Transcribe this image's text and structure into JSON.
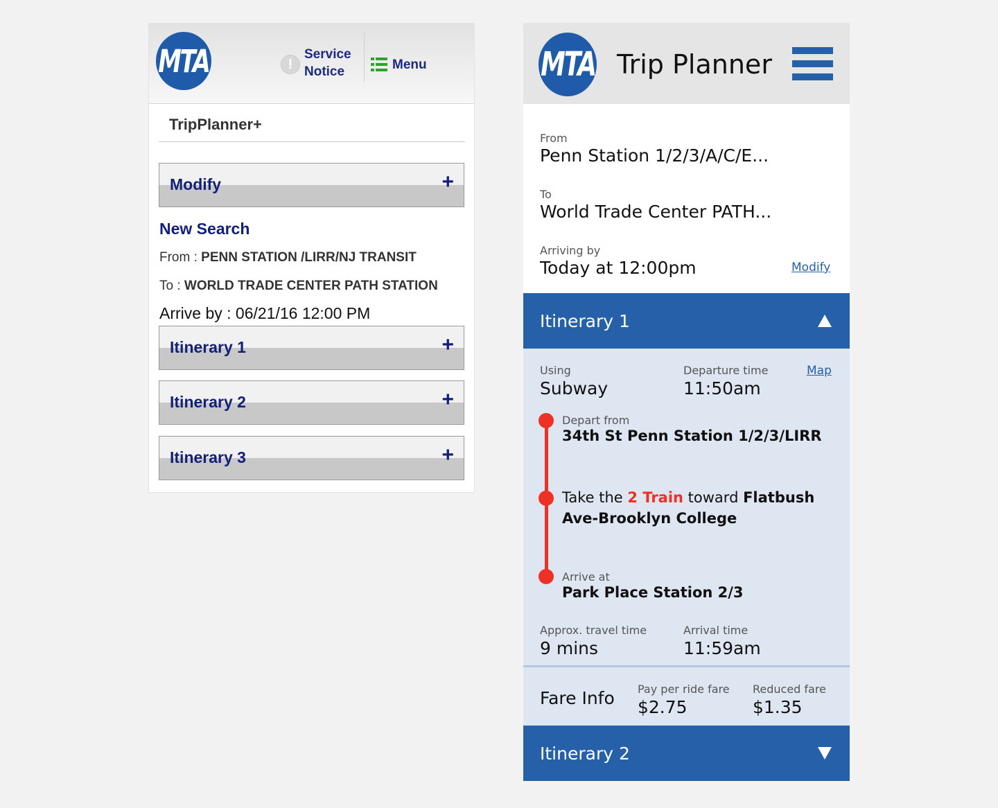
{
  "old_app": {
    "logo_text": "MTA",
    "service_notice": "Service Notice",
    "menu_label": "Menu",
    "section_title": "TripPlanner+",
    "modify_label": "Modify",
    "new_search_label": "New Search",
    "from_label": "From :",
    "from_value": "PENN STATION /LIRR/NJ TRANSIT",
    "to_label": "To :",
    "to_value": "WORLD TRADE CENTER PATH STATION",
    "arrive_by": "Arrive by : 06/21/16  12:00 PM",
    "itineraries": [
      "Itinerary 1",
      "Itinerary 2",
      "Itinerary 3"
    ],
    "plus_glyph": "+",
    "accent_color": "#13207a"
  },
  "new_app": {
    "logo_text": "MTA",
    "title": "Trip Planner",
    "from_label": "From",
    "from_value": "Penn Station 1/2/3/A/C/E...",
    "to_label": "To",
    "to_value": "World Trade Center PATH...",
    "arriving_label": "Arriving by",
    "arriving_value": "Today at 12:00pm",
    "modify_link": "Modify",
    "itinerary1": {
      "label": "Itinerary 1",
      "using_label": "Using",
      "using_value": "Subway",
      "departure_label": "Departure time",
      "departure_value": "11:50am",
      "map_link": "Map",
      "depart_from_label": "Depart from",
      "depart_from_value": "34th St Penn Station 1/2/3/LIRR",
      "take_prefix": "Take the ",
      "train": "2 Train",
      "toward": " toward ",
      "destination": "Flatbush Ave-Brooklyn College",
      "arrive_at_label": "Arrive at",
      "arrive_at_value": "Park Place Station 2/3",
      "travel_label": "Approx. travel time",
      "travel_value": "9 mins",
      "arrival_label": "Arrival time",
      "arrival_value": "11:59am"
    },
    "fare": {
      "title": "Fare Info",
      "per_ride_label": "Pay per ride fare",
      "per_ride_value": "$2.75",
      "reduced_label": "Reduced fare",
      "reduced_value": "$1.35"
    },
    "itinerary2_label": "Itinerary 2",
    "brand_color": "#2560a8",
    "line_color": "#ee3124"
  }
}
